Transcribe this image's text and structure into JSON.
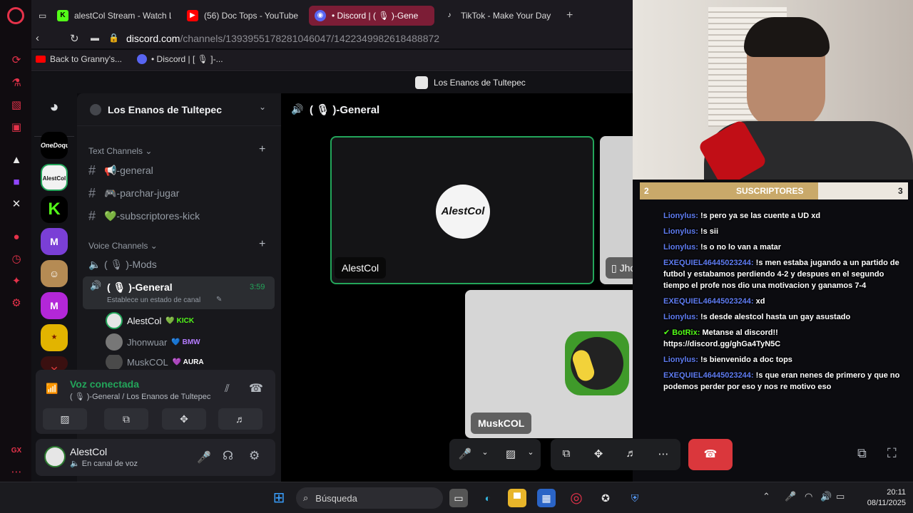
{
  "browser": {
    "tabs": [
      {
        "title": "alestCol Stream - Watch L",
        "icon": "kick-icon"
      },
      {
        "title": "(56) Doc Tops - YouTube",
        "icon": "youtube-icon"
      },
      {
        "title": "• Discord | ( 🎙 )-Gene",
        "icon": "discord-icon",
        "active": true
      },
      {
        "title": "TikTok - Make Your Day",
        "icon": "tiktok-icon"
      }
    ],
    "new_tab": "+",
    "url_host": "discord.com",
    "url_path": "/channels/1393955178281046047/1422349982618488872",
    "bookmarks": [
      {
        "label": "Back to Granny's...",
        "icon": "youtube-icon"
      },
      {
        "label": "• Discord | [ 🎙 ]-...",
        "icon": "discord-icon"
      }
    ]
  },
  "discord": {
    "window_title": "Los Enanos de Tultepec",
    "server_name": "Los Enanos de Tultepec",
    "text_category": "Text Channels",
    "text_channels": [
      "📢-general",
      "🎮-parchar-jugar",
      "💚-subscriptores-kick"
    ],
    "voice_category": "Voice Channels",
    "voice_channels": [
      {
        "name": "( 🎙 )-Mods"
      },
      {
        "name": "( 🎙 )-General",
        "time": "3:59",
        "status": "Establece un estado de canal"
      }
    ],
    "voice_users": [
      {
        "name": "AlestCol",
        "tag": "KICK",
        "tag_icon": "💚",
        "tag_color": "#53fc18"
      },
      {
        "name": "Jhonwuar",
        "tag": "BMW",
        "tag_icon": "💙",
        "tag_color": "#6ea6ff"
      },
      {
        "name": "MuskCOL",
        "tag": "AURA",
        "tag_icon": "💜",
        "tag_color": "#b57cff"
      }
    ],
    "voice_panel": {
      "status": "Voz conectada",
      "location": "( 🎙 )-General / Los Enanos de Tultepec"
    },
    "user_panel": {
      "name": "AlestCol",
      "status": "En canal de voz"
    },
    "stage_title": "( 🎙 )-General",
    "tiles": [
      {
        "name": "AlestCol",
        "logo": "AlestCol"
      },
      {
        "name": "Jhonwuar"
      },
      {
        "name": "MuskCOL"
      }
    ]
  },
  "stream_overlay": {
    "subs_left": "2",
    "subs_label": "SUSCRIPTORES",
    "subs_right": "3",
    "chat": [
      {
        "user": "Lionylus:",
        "text": "!s pero ya se las cuente a UD xd"
      },
      {
        "user": "Lionylus:",
        "text": "!s sii"
      },
      {
        "user": "Lionylus:",
        "text": "!s o no lo van a matar"
      },
      {
        "user": "EXEQUIEL46445023244:",
        "text": "!s men estaba jugando a un partido de futbol y estabamos perdiendo 4-2 y despues en el segundo tiempo el profe nos dio una motivacion y ganamos 7-4"
      },
      {
        "user": "EXEQUIEL46445023244:",
        "text": "xd"
      },
      {
        "user": "Lionylus:",
        "text": "!s desde alestcol hasta un gay asustado"
      },
      {
        "user": "BotRix:",
        "text": "Metanse al discord!! https://discord.gg/ghGa4TyN5C"
      },
      {
        "user": "Lionylus:",
        "text": "!s bienvenido a doc tops"
      },
      {
        "user": "EXEQUIEL46445023244:",
        "text": "!s que eran nenes de primero y que no podemos perder por eso y nos re motivo eso"
      }
    ]
  },
  "taskbar": {
    "search_placeholder": "Búsqueda",
    "time": "20:11",
    "date": "08/11/2025"
  },
  "colors": {
    "discord_green": "#23a55a",
    "accent_red": "#e5324a",
    "hangup_red": "#da373c",
    "kick_green": "#53fc18"
  }
}
